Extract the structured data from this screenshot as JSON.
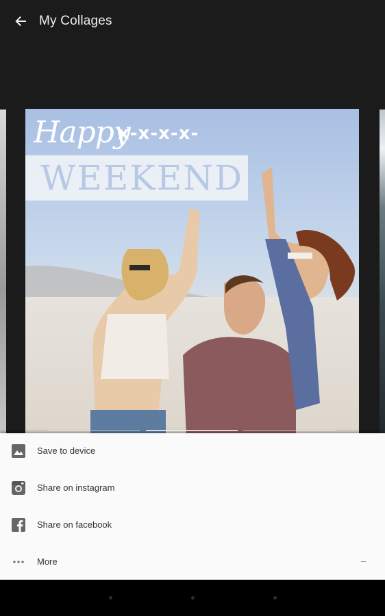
{
  "header": {
    "title": "My Collages",
    "back_icon": "arrow-back-icon"
  },
  "collage": {
    "headline_top": "Happy",
    "decoration": "x-x-x-x-",
    "headline_bottom": "WEEKEND"
  },
  "share_sheet": {
    "items": [
      {
        "label": "Save to device",
        "icon": "gallery-icon"
      },
      {
        "label": "Share on instagram",
        "icon": "instagram-icon"
      },
      {
        "label": "Share on facebook",
        "icon": "facebook-icon"
      },
      {
        "label": "More",
        "icon": "more-dots-icon",
        "trailing": "–"
      }
    ]
  },
  "colors": {
    "app_bar": "#1b1b1b",
    "sheet_bg": "#fafafa",
    "nav_bar": "#000000",
    "weekend_text": "#b7c8e4"
  }
}
